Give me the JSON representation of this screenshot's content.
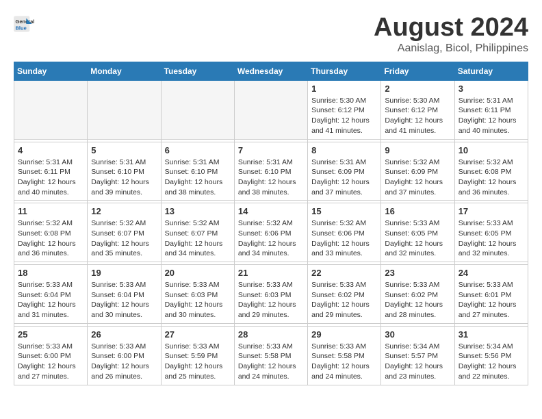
{
  "logo": {
    "general": "General",
    "blue": "Blue"
  },
  "title": "August 2024",
  "subtitle": "Aanislag, Bicol, Philippines",
  "days_of_week": [
    "Sunday",
    "Monday",
    "Tuesday",
    "Wednesday",
    "Thursday",
    "Friday",
    "Saturday"
  ],
  "weeks": [
    [
      {
        "day": "",
        "info": "",
        "empty": true
      },
      {
        "day": "",
        "info": "",
        "empty": true
      },
      {
        "day": "",
        "info": "",
        "empty": true
      },
      {
        "day": "",
        "info": "",
        "empty": true
      },
      {
        "day": "1",
        "info": "Sunrise: 5:30 AM\nSunset: 6:12 PM\nDaylight: 12 hours\nand 41 minutes."
      },
      {
        "day": "2",
        "info": "Sunrise: 5:30 AM\nSunset: 6:12 PM\nDaylight: 12 hours\nand 41 minutes."
      },
      {
        "day": "3",
        "info": "Sunrise: 5:31 AM\nSunset: 6:11 PM\nDaylight: 12 hours\nand 40 minutes."
      }
    ],
    [
      {
        "day": "4",
        "info": "Sunrise: 5:31 AM\nSunset: 6:11 PM\nDaylight: 12 hours\nand 40 minutes."
      },
      {
        "day": "5",
        "info": "Sunrise: 5:31 AM\nSunset: 6:10 PM\nDaylight: 12 hours\nand 39 minutes."
      },
      {
        "day": "6",
        "info": "Sunrise: 5:31 AM\nSunset: 6:10 PM\nDaylight: 12 hours\nand 38 minutes."
      },
      {
        "day": "7",
        "info": "Sunrise: 5:31 AM\nSunset: 6:10 PM\nDaylight: 12 hours\nand 38 minutes."
      },
      {
        "day": "8",
        "info": "Sunrise: 5:31 AM\nSunset: 6:09 PM\nDaylight: 12 hours\nand 37 minutes."
      },
      {
        "day": "9",
        "info": "Sunrise: 5:32 AM\nSunset: 6:09 PM\nDaylight: 12 hours\nand 37 minutes."
      },
      {
        "day": "10",
        "info": "Sunrise: 5:32 AM\nSunset: 6:08 PM\nDaylight: 12 hours\nand 36 minutes."
      }
    ],
    [
      {
        "day": "11",
        "info": "Sunrise: 5:32 AM\nSunset: 6:08 PM\nDaylight: 12 hours\nand 36 minutes."
      },
      {
        "day": "12",
        "info": "Sunrise: 5:32 AM\nSunset: 6:07 PM\nDaylight: 12 hours\nand 35 minutes."
      },
      {
        "day": "13",
        "info": "Sunrise: 5:32 AM\nSunset: 6:07 PM\nDaylight: 12 hours\nand 34 minutes."
      },
      {
        "day": "14",
        "info": "Sunrise: 5:32 AM\nSunset: 6:06 PM\nDaylight: 12 hours\nand 34 minutes."
      },
      {
        "day": "15",
        "info": "Sunrise: 5:32 AM\nSunset: 6:06 PM\nDaylight: 12 hours\nand 33 minutes."
      },
      {
        "day": "16",
        "info": "Sunrise: 5:33 AM\nSunset: 6:05 PM\nDaylight: 12 hours\nand 32 minutes."
      },
      {
        "day": "17",
        "info": "Sunrise: 5:33 AM\nSunset: 6:05 PM\nDaylight: 12 hours\nand 32 minutes."
      }
    ],
    [
      {
        "day": "18",
        "info": "Sunrise: 5:33 AM\nSunset: 6:04 PM\nDaylight: 12 hours\nand 31 minutes."
      },
      {
        "day": "19",
        "info": "Sunrise: 5:33 AM\nSunset: 6:04 PM\nDaylight: 12 hours\nand 30 minutes."
      },
      {
        "day": "20",
        "info": "Sunrise: 5:33 AM\nSunset: 6:03 PM\nDaylight: 12 hours\nand 30 minutes."
      },
      {
        "day": "21",
        "info": "Sunrise: 5:33 AM\nSunset: 6:03 PM\nDaylight: 12 hours\nand 29 minutes."
      },
      {
        "day": "22",
        "info": "Sunrise: 5:33 AM\nSunset: 6:02 PM\nDaylight: 12 hours\nand 29 minutes."
      },
      {
        "day": "23",
        "info": "Sunrise: 5:33 AM\nSunset: 6:02 PM\nDaylight: 12 hours\nand 28 minutes."
      },
      {
        "day": "24",
        "info": "Sunrise: 5:33 AM\nSunset: 6:01 PM\nDaylight: 12 hours\nand 27 minutes."
      }
    ],
    [
      {
        "day": "25",
        "info": "Sunrise: 5:33 AM\nSunset: 6:00 PM\nDaylight: 12 hours\nand 27 minutes."
      },
      {
        "day": "26",
        "info": "Sunrise: 5:33 AM\nSunset: 6:00 PM\nDaylight: 12 hours\nand 26 minutes."
      },
      {
        "day": "27",
        "info": "Sunrise: 5:33 AM\nSunset: 5:59 PM\nDaylight: 12 hours\nand 25 minutes."
      },
      {
        "day": "28",
        "info": "Sunrise: 5:33 AM\nSunset: 5:58 PM\nDaylight: 12 hours\nand 24 minutes."
      },
      {
        "day": "29",
        "info": "Sunrise: 5:33 AM\nSunset: 5:58 PM\nDaylight: 12 hours\nand 24 minutes."
      },
      {
        "day": "30",
        "info": "Sunrise: 5:34 AM\nSunset: 5:57 PM\nDaylight: 12 hours\nand 23 minutes."
      },
      {
        "day": "31",
        "info": "Sunrise: 5:34 AM\nSunset: 5:56 PM\nDaylight: 12 hours\nand 22 minutes."
      }
    ]
  ]
}
